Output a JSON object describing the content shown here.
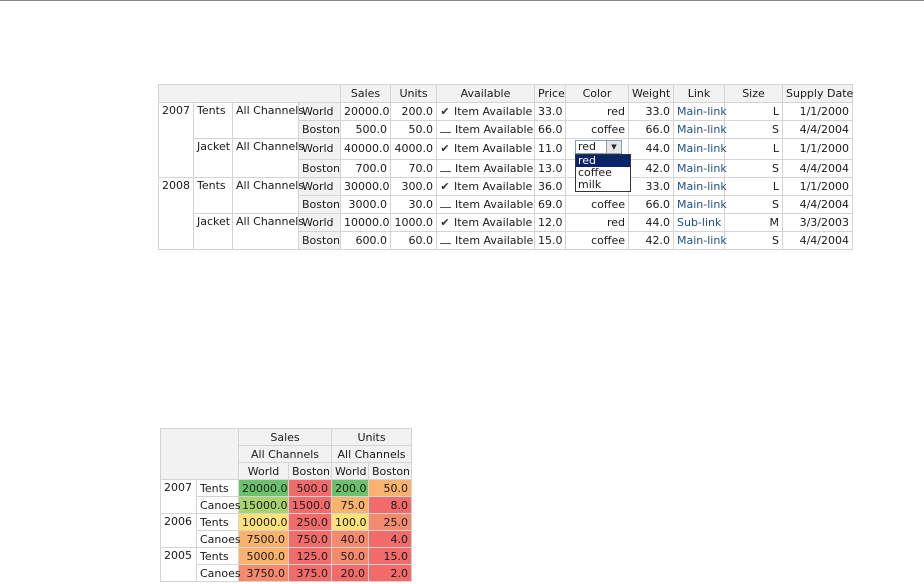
{
  "pivot1": {
    "headers": [
      "Sales",
      "Units",
      "Available",
      "Price",
      "Color",
      "Weight",
      "Link",
      "Size",
      "Supply Date"
    ],
    "groups": [
      {
        "year": "2007",
        "products": [
          {
            "product": "Tents",
            "channel": "All Channels",
            "rows": [
              {
                "location": "World",
                "sales": "20000.0",
                "units": "200.0",
                "available": true,
                "avail_label": "Item Available",
                "price": "33.0",
                "color": "red",
                "weight": "33.0",
                "link": "Main-link",
                "size": "L",
                "date": "1/1/2000"
              },
              {
                "location": "Boston",
                "sales": "500.0",
                "units": "50.0",
                "available": false,
                "avail_label": "Item Available",
                "price": "66.0",
                "color": "coffee",
                "weight": "66.0",
                "link": "Main-link",
                "size": "S",
                "date": "4/4/2004"
              }
            ]
          },
          {
            "product": "Jacket",
            "channel": "All Channels",
            "rows": [
              {
                "location": "World",
                "sales": "40000.0",
                "units": "4000.0",
                "available": true,
                "avail_label": "Item Available",
                "price": "11.0",
                "color": "red",
                "weight": "44.0",
                "link": "Main-link",
                "size": "L",
                "date": "1/1/2000"
              },
              {
                "location": "Boston",
                "sales": "700.0",
                "units": "70.0",
                "available": false,
                "avail_label": "Item Available",
                "price": "13.0",
                "color": "",
                "weight": "42.0",
                "link": "Main-link",
                "size": "S",
                "date": "4/4/2004"
              }
            ]
          }
        ]
      },
      {
        "year": "2008",
        "products": [
          {
            "product": "Tents",
            "channel": "All Channels",
            "rows": [
              {
                "location": "World",
                "sales": "30000.0",
                "units": "300.0",
                "available": true,
                "avail_label": "Item Available",
                "price": "36.0",
                "color": "",
                "weight": "33.0",
                "link": "Main-link",
                "size": "L",
                "date": "1/1/2000"
              },
              {
                "location": "Boston",
                "sales": "3000.0",
                "units": "30.0",
                "available": false,
                "avail_label": "Item Available",
                "price": "69.0",
                "color": "coffee",
                "weight": "66.0",
                "link": "Main-link",
                "size": "S",
                "date": "4/4/2004"
              }
            ]
          },
          {
            "product": "Jacket",
            "channel": "All Channels",
            "rows": [
              {
                "location": "World",
                "sales": "10000.0",
                "units": "1000.0",
                "available": true,
                "avail_label": "Item Available",
                "price": "12.0",
                "color": "red",
                "weight": "44.0",
                "link": "Sub-link",
                "size": "M",
                "date": "3/3/2003"
              },
              {
                "location": "Boston",
                "sales": "600.0",
                "units": "60.0",
                "available": false,
                "avail_label": "Item Available",
                "price": "15.0",
                "color": "coffee",
                "weight": "42.0",
                "link": "Main-link",
                "size": "S",
                "date": "4/4/2004"
              }
            ]
          }
        ]
      }
    ],
    "editor": {
      "value": "red",
      "options": [
        "red",
        "coffee",
        "milk"
      ],
      "selected": "red"
    }
  },
  "pivot2": {
    "measures": [
      "Sales",
      "Units"
    ],
    "channel": "All Channels",
    "locations": [
      "World",
      "Boston"
    ],
    "colors": {
      "green": "#6cc26c",
      "lgreen": "#a9d36f",
      "yellow": "#fde27a",
      "orange": "#f9b36d",
      "salmon": "#f58b6e",
      "red": "#f26b6b"
    },
    "rows": [
      {
        "year": "2007",
        "product": "Tents",
        "cells": [
          {
            "v": "20000.0",
            "c": "green"
          },
          {
            "v": "500.0",
            "c": "red"
          },
          {
            "v": "200.0",
            "c": "green"
          },
          {
            "v": "50.0",
            "c": "orange"
          }
        ]
      },
      {
        "year": "2007",
        "product": "Canoes",
        "cells": [
          {
            "v": "15000.0",
            "c": "lgreen"
          },
          {
            "v": "1500.0",
            "c": "red"
          },
          {
            "v": "75.0",
            "c": "orange"
          },
          {
            "v": "8.0",
            "c": "red"
          }
        ]
      },
      {
        "year": "2006",
        "product": "Tents",
        "cells": [
          {
            "v": "10000.0",
            "c": "yellow"
          },
          {
            "v": "250.0",
            "c": "red"
          },
          {
            "v": "100.0",
            "c": "yellow"
          },
          {
            "v": "25.0",
            "c": "salmon"
          }
        ]
      },
      {
        "year": "2006",
        "product": "Canoes",
        "cells": [
          {
            "v": "7500.0",
            "c": "orange"
          },
          {
            "v": "750.0",
            "c": "red"
          },
          {
            "v": "40.0",
            "c": "salmon"
          },
          {
            "v": "4.0",
            "c": "red"
          }
        ]
      },
      {
        "year": "2005",
        "product": "Tents",
        "cells": [
          {
            "v": "5000.0",
            "c": "orange"
          },
          {
            "v": "125.0",
            "c": "red"
          },
          {
            "v": "50.0",
            "c": "salmon"
          },
          {
            "v": "15.0",
            "c": "red"
          }
        ]
      },
      {
        "year": "2005",
        "product": "Canoes",
        "cells": [
          {
            "v": "3750.0",
            "c": "salmon"
          },
          {
            "v": "375.0",
            "c": "red"
          },
          {
            "v": "20.0",
            "c": "red"
          },
          {
            "v": "2.0",
            "c": "red"
          }
        ]
      }
    ]
  }
}
